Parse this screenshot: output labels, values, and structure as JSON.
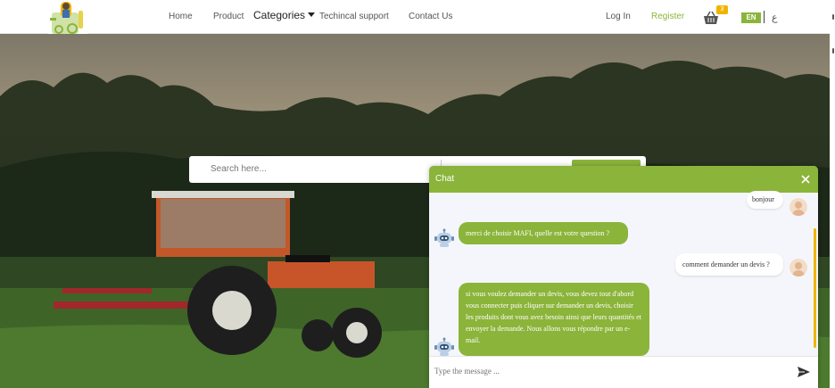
{
  "nav": {
    "links": {
      "home": "Home",
      "product": "Product",
      "categories": "Categories",
      "support": "Techincal support",
      "contact": "Contact Us"
    },
    "login": "Log In",
    "register": "Register",
    "cart_count": "3",
    "lang_en": "EN",
    "lang_ar": "ع"
  },
  "search": {
    "placeholder": "Search here..."
  },
  "chat": {
    "title": "Chat",
    "messages": [
      {
        "from": "user",
        "text": "bonjour"
      },
      {
        "from": "bot",
        "text": "merci de choisir MAFI, quelle est votre question ?"
      },
      {
        "from": "user",
        "text": "comment demander un devis ?"
      },
      {
        "from": "bot",
        "text": "si vous voulez demander un devis, vous devez tout d'abord vous connecter puis cliquer sur demander un devis, choisir les produits dont vous avez besoin ainsi que leurs quantités et envoyer la demande. Nous allons vous répondre par un e-mail."
      }
    ],
    "input_placeholder": "Type the message ..."
  },
  "colors": {
    "accent": "#8bb43a",
    "badge": "#f0b400"
  },
  "icons": {
    "cart": "basket-icon",
    "close": "close-icon",
    "send": "send-icon",
    "bot": "robot-icon",
    "user": "user-avatar-icon"
  }
}
